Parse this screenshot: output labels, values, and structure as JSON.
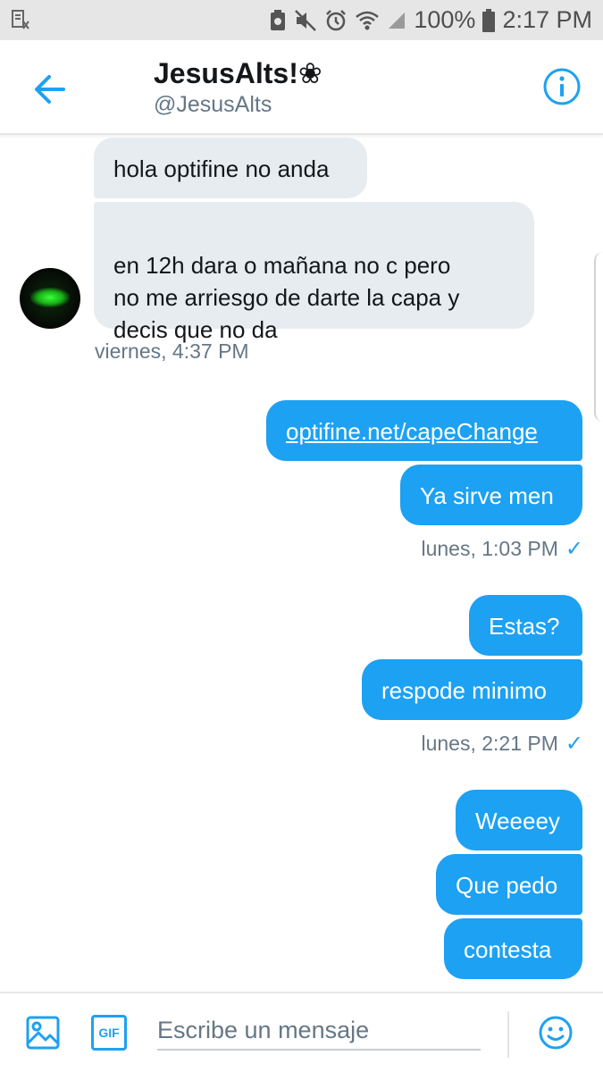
{
  "status_bar": {
    "battery": "100%",
    "time": "2:17 PM"
  },
  "header": {
    "name": "JesusAlts!❀",
    "handle": "@JesusAlts"
  },
  "conversation": {
    "incoming": [
      {
        "text": "hola optifine no anda"
      },
      {
        "text": "en 12h dara o  mañana no  c pero\nno me arriesgo de darte la capa y\ndecis que no da"
      }
    ],
    "incoming_timestamp": "viernes, 4:37 PM",
    "group1": [
      {
        "text": "optifine.net/capeChange"
      },
      {
        "text": "Ya sirve men"
      }
    ],
    "group1_timestamp": "lunes, 1:03 PM",
    "group2": [
      {
        "text": "Estas?"
      },
      {
        "text": "respode minimo"
      }
    ],
    "group2_timestamp": "lunes, 2:21 PM",
    "group3": [
      {
        "text": "Weeeey"
      },
      {
        "text": "Que pedo"
      },
      {
        "text": "contesta"
      }
    ],
    "read_check": "✓"
  },
  "composer": {
    "placeholder": "Escribe un mensaje",
    "gif_label": "GIF"
  },
  "colors": {
    "accent": "#1da1f2",
    "incoming_bubble": "#e6ecf0"
  },
  "icons": [
    "back-arrow-icon",
    "info-icon",
    "image-icon",
    "gif-icon",
    "emoji-icon"
  ]
}
